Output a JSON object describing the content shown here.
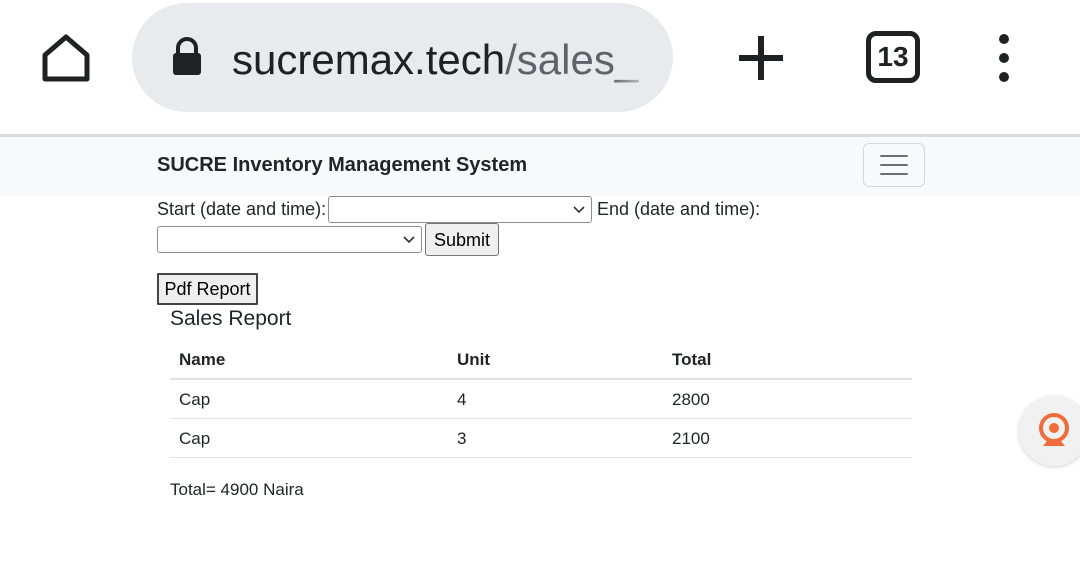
{
  "browser": {
    "url_host": "sucremax.tech",
    "url_path": "/sales_",
    "tab_count": "13",
    "icons": {
      "home": "home-icon",
      "lock": "lock-icon",
      "new_tab": "plus-icon",
      "tabs": "tab-switcher-icon",
      "menu": "kebab-menu-icon"
    }
  },
  "navbar": {
    "brand": "SUCRE Inventory Management System",
    "toggler_icon": "hamburger-icon"
  },
  "form": {
    "start_label": "Start (date and time):",
    "start_value": "",
    "end_label": "End (date and time):",
    "end_value": "",
    "submit_label": "Submit",
    "pdf_label": "Pdf Report"
  },
  "report": {
    "title": "Sales Report",
    "columns": [
      "Name",
      "Unit",
      "Total"
    ],
    "rows": [
      [
        "Cap",
        "4",
        "2800"
      ],
      [
        "Cap",
        "3",
        "2100"
      ]
    ],
    "total_text": "Total= 4900 Naira"
  },
  "floating_widget": {
    "icon": "webcam-icon",
    "accent": "#f26b3a"
  },
  "colors": {
    "navbar_bg": "#f8f9fa",
    "url_bar_bg": "#e8eaed",
    "text": "#212529"
  }
}
